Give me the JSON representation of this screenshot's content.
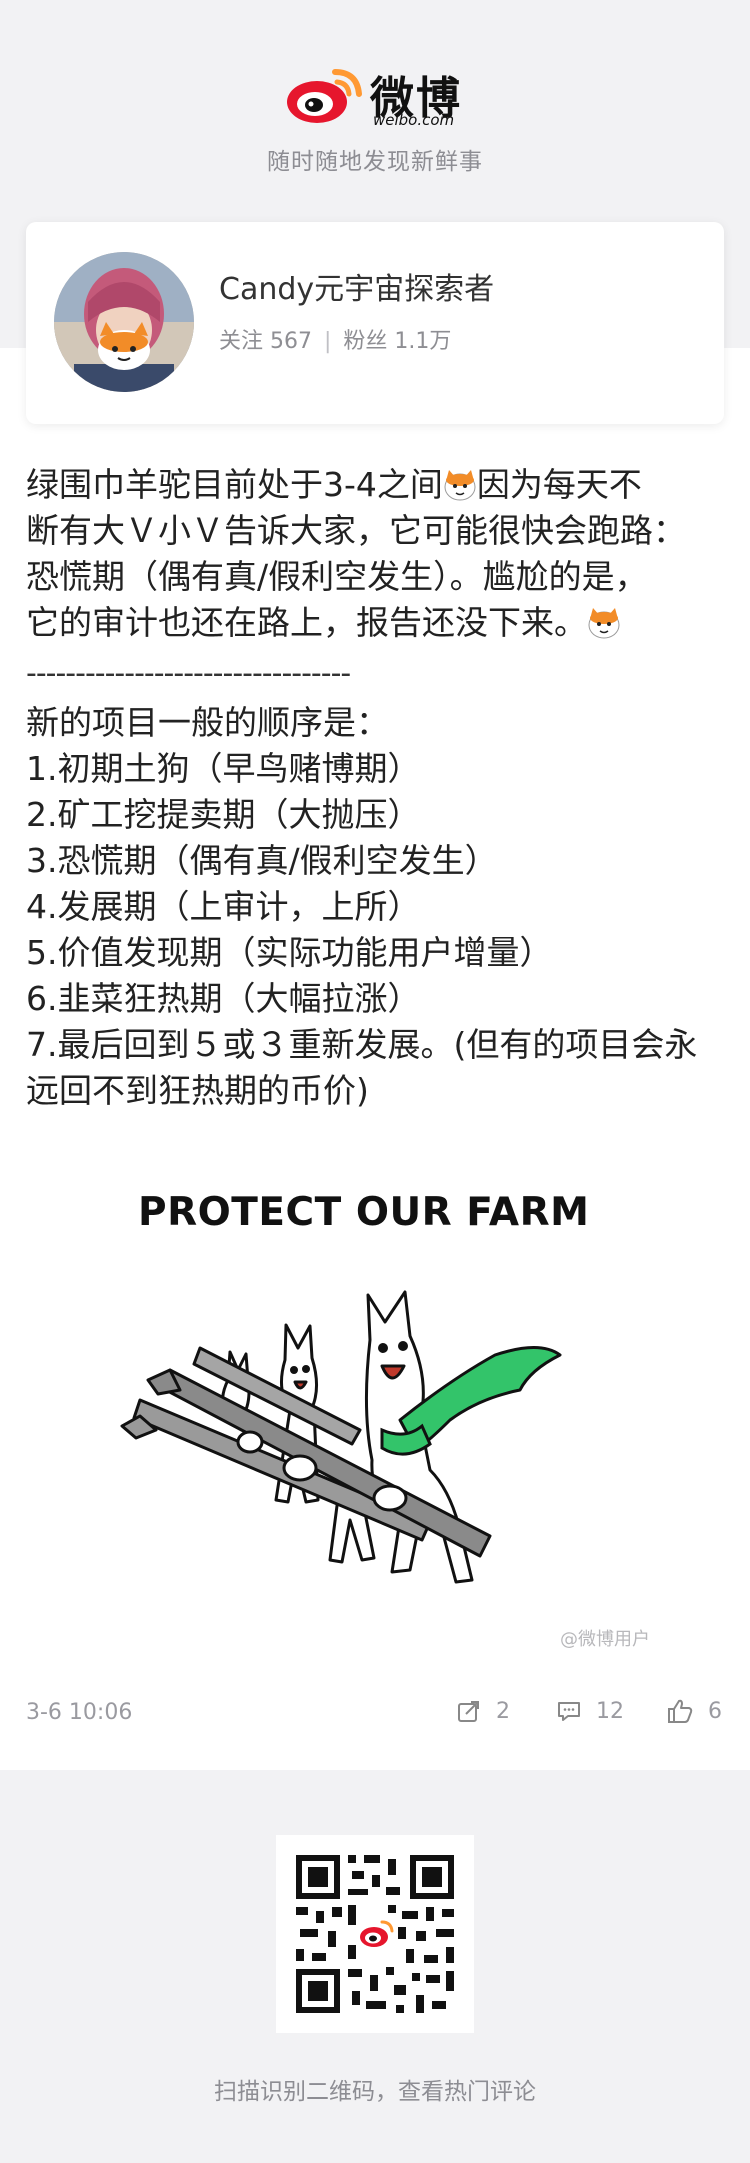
{
  "brand": {
    "name": "微博",
    "domain": "weibo.com",
    "tagline": "随时随地发现新鲜事"
  },
  "author": {
    "name": "Candy元宇宙探索者",
    "following_label": "关注 567",
    "followers_label": "粉丝 1.1万"
  },
  "post": {
    "line1a": "绿围巾羊驼目前处于3-4之间",
    "line1b": "因为每天不",
    "line2": "断有大Ｖ小Ｖ告诉大家，它可能很快会跑路：",
    "line3": "恐慌期（偶有真/假利空发生）。尴尬的是，",
    "line4": "它的审计也还在路上，报告还没下来。",
    "divider": "---------------------------------",
    "list_heading": "新的项目一般的顺序是：",
    "items": [
      "1.初期土狗（早鸟赌博期）",
      "2.矿工挖提卖期（大抛压）",
      "3.恐慌期（偶有真/假利空发生）",
      "4.发展期（上审计，上所）",
      "5.价值发现期（实际功能用户增量）",
      "6.韭菜狂热期（大幅拉涨）",
      "7.最后回到５或３重新发展。(但有的项目会永",
      "远回不到狂热期的币价)"
    ]
  },
  "image": {
    "title": "PROTECT OUR FARM",
    "credit": "@微博用户"
  },
  "meta": {
    "timestamp": "3-6 10:06",
    "shares": "2",
    "comments": "12",
    "likes": "6"
  },
  "footer": {
    "qr_caption": "扫描识别二维码，查看热门评论"
  },
  "colors": {
    "accent_red": "#e6162d",
    "accent_orange": "#ff9933",
    "scarf_green": "#33c46a"
  }
}
